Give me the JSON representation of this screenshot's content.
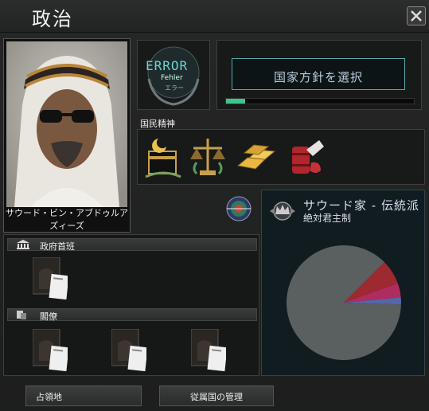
{
  "window": {
    "title": "政治",
    "close_icon": "close-icon"
  },
  "leader": {
    "name_line1": "サウード・ビン・アブドゥルア",
    "name_line2": "ズィーズ"
  },
  "error_box": {
    "code": "ERROR",
    "sub1": "Fehler",
    "sub2": "エラー"
  },
  "focus": {
    "label": "国家方針を選択",
    "progress": 0.1
  },
  "national_spirits": {
    "header": "国民精神",
    "icons": [
      "kaaba-icon",
      "scales-icon",
      "gold-bars-icon",
      "oil-barrel-icon"
    ]
  },
  "ruling_party": {
    "name": "サウード家 - 伝統派",
    "government": "絶対君主制",
    "icon": "crown-icon"
  },
  "politics_globe": {
    "icon": "globe-icon"
  },
  "cabinet": {
    "head_section": "政府首班",
    "ministers_section": "閣僚",
    "head_icon": "government-building-icon",
    "ministers_icon": "cabinet-icon"
  },
  "pie_chart": {
    "slices": [
      {
        "label": "traditionalist",
        "value": 87,
        "color": "#5a5f60"
      },
      {
        "label": "red",
        "value": 7,
        "color": "#9c2a30"
      },
      {
        "label": "pink",
        "value": 4,
        "color": "#b02c60"
      },
      {
        "label": "blue",
        "value": 2,
        "color": "#5566aa"
      }
    ]
  },
  "buttons": {
    "occupied": "占領地",
    "subjects": "従属国の管理"
  },
  "colors": {
    "accent": "#3ac68f",
    "teal": "#6bd2d2"
  }
}
